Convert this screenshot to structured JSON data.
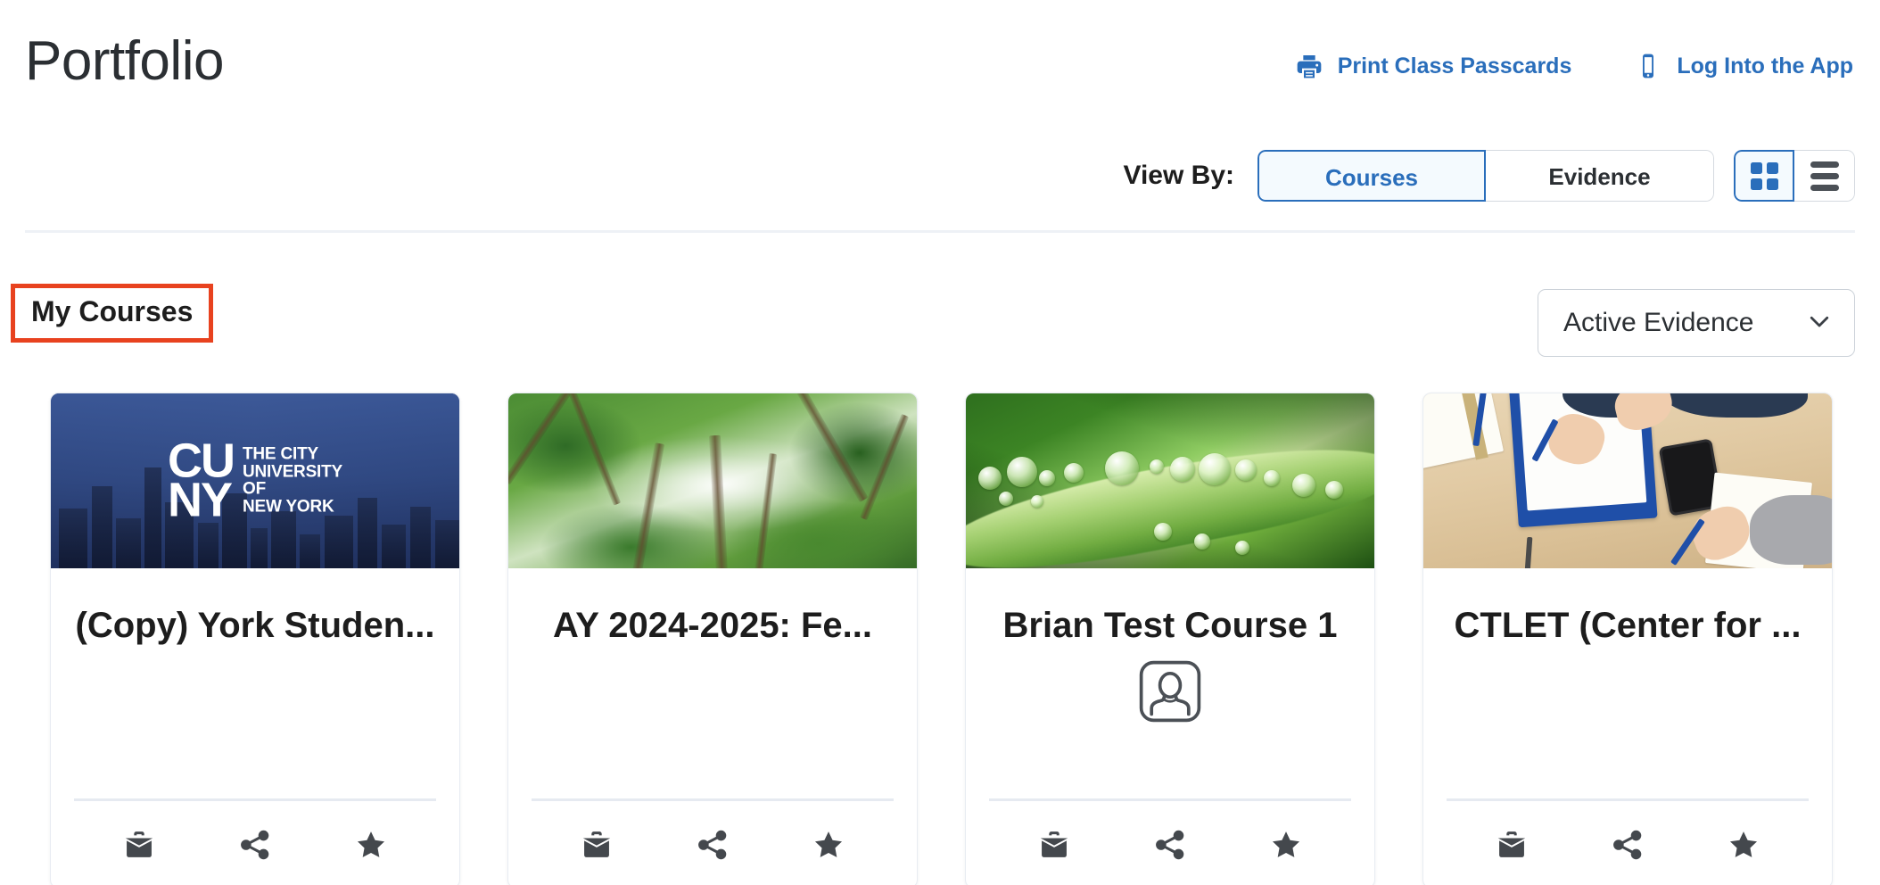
{
  "header": {
    "title": "Portfolio",
    "links": [
      {
        "label": "Print Class Passcards",
        "icon": "printer-icon"
      },
      {
        "label": "Log Into the App",
        "icon": "mobile-phone-icon"
      }
    ]
  },
  "toolbar": {
    "view_by_label": "View By:",
    "view_modes": [
      {
        "label": "Courses",
        "active": true
      },
      {
        "label": "Evidence",
        "active": false
      }
    ],
    "layouts": [
      {
        "name": "grid-view",
        "icon": "grid-icon",
        "active": true
      },
      {
        "name": "list-view",
        "icon": "list-icon",
        "active": false
      }
    ]
  },
  "section": {
    "title": "My Courses",
    "highlight_color": "#e8421f",
    "filter": {
      "selected": "Active Evidence",
      "icon": "chevron-down-icon"
    }
  },
  "colors": {
    "accent_blue": "#2a6ebb",
    "text_dark": "#1d1d1d",
    "divider": "#eef1f6",
    "icon_gray": "#44484d"
  },
  "courses": [
    {
      "title": "(Copy) York Studen...",
      "banner": "cuny-skyline-image",
      "banner_text": {
        "mark": "CU\nNY",
        "words": "The City\nUniversity of\nNew York"
      },
      "has_avatar": false,
      "actions": [
        {
          "name": "portfolio-icon",
          "label": "Portfolio"
        },
        {
          "name": "share-icon",
          "label": "Share"
        },
        {
          "name": "star-icon",
          "label": "Favorite"
        }
      ]
    },
    {
      "title": "AY 2024-2025: Fe...",
      "banner": "forest-canopy-image",
      "has_avatar": false,
      "actions": [
        {
          "name": "portfolio-icon",
          "label": "Portfolio"
        },
        {
          "name": "share-icon",
          "label": "Share"
        },
        {
          "name": "star-icon",
          "label": "Favorite"
        }
      ]
    },
    {
      "title": "Brian Test Course 1",
      "banner": "dew-on-leaf-image",
      "has_avatar": true,
      "avatar_icon": "user-placeholder-icon",
      "actions": [
        {
          "name": "portfolio-icon",
          "label": "Portfolio"
        },
        {
          "name": "share-icon",
          "label": "Share"
        },
        {
          "name": "star-icon",
          "label": "Favorite"
        }
      ]
    },
    {
      "title": "CTLET (Center for ...",
      "banner": "students-writing-at-desk-image",
      "has_avatar": false,
      "actions": [
        {
          "name": "portfolio-icon",
          "label": "Portfolio"
        },
        {
          "name": "share-icon",
          "label": "Share"
        },
        {
          "name": "star-icon",
          "label": "Favorite"
        }
      ]
    }
  ]
}
